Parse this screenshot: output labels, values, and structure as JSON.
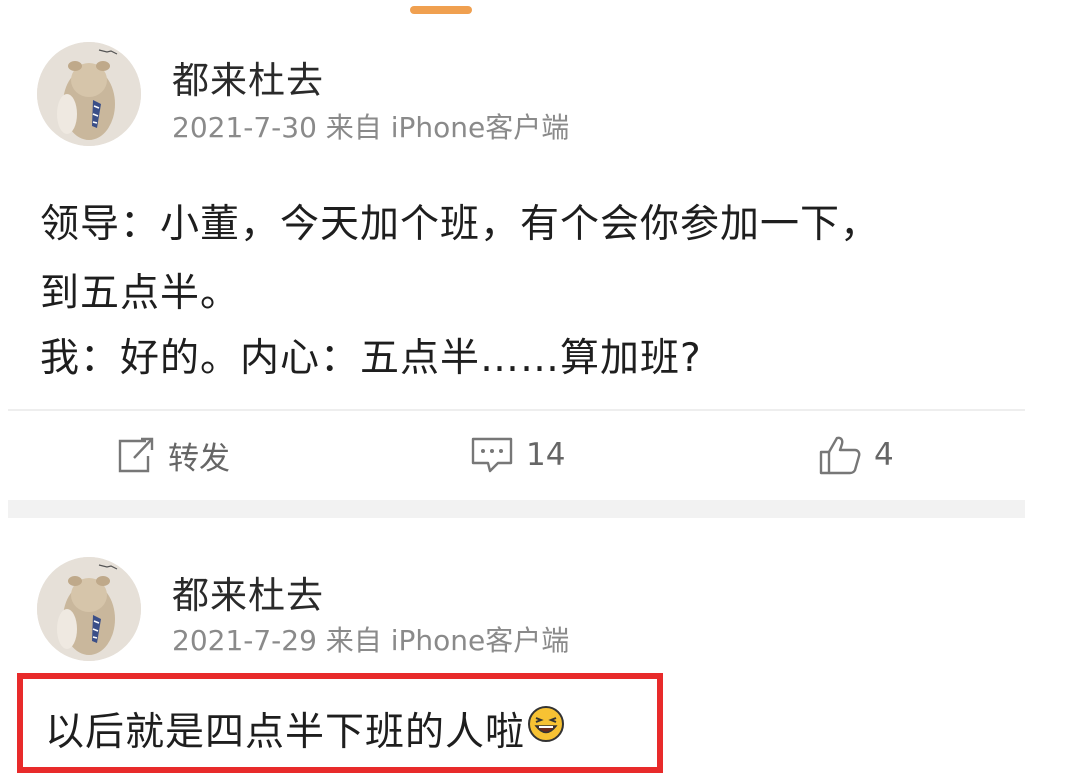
{
  "posts": [
    {
      "username": "都来杜去",
      "meta": "2021-7-30 来自 iPhone客户端",
      "lines": [
        "领导：小董，今天加个班，有个会你参加一下，",
        "到五点半。",
        "我：好的。内心：五点半……算加班?"
      ],
      "actions": {
        "repost_label": "转发",
        "comment_count": "14",
        "like_count": "4"
      }
    },
    {
      "username": "都来杜去",
      "meta": "2021-7-29 来自 iPhone客户端",
      "text": "以后就是四点半下班的人啦",
      "emoji": "laughing-emoji"
    }
  ],
  "icons": {
    "repost": "repost-icon",
    "comment": "comment-icon",
    "like": "thumbs-up-icon"
  },
  "colors": {
    "highlight": "#e82a2a",
    "top_handle": "#f0a050",
    "meta_text": "#8a8a8a"
  }
}
